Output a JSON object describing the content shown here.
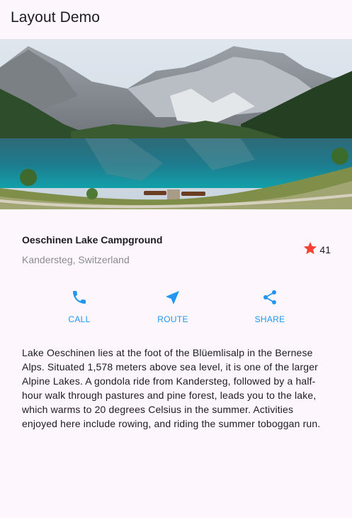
{
  "app_bar": {
    "title": "Layout Demo"
  },
  "title_section": {
    "name": "Oeschinen Lake Campground",
    "location": "Kandersteg, Switzerland",
    "favorite_count": "41",
    "star_color": "#f44336"
  },
  "buttons": [
    {
      "label": "CALL",
      "icon": "phone-icon"
    },
    {
      "label": "ROUTE",
      "icon": "near-me-icon"
    },
    {
      "label": "SHARE",
      "icon": "share-icon"
    }
  ],
  "accent_color": "#2196f3",
  "description": "Lake Oeschinen lies at the foot of the Blüemlisalp in the Bernese Alps. Situated 1,578 meters above sea level, it is one of the larger Alpine Lakes. A gondola ride from Kandersteg, followed by a half-hour walk through pastures and pine forest, leads you to the lake, which warms to 20 degrees Celsius in the summer. Activities enjoyed here include rowing, and riding the summer toboggan run."
}
